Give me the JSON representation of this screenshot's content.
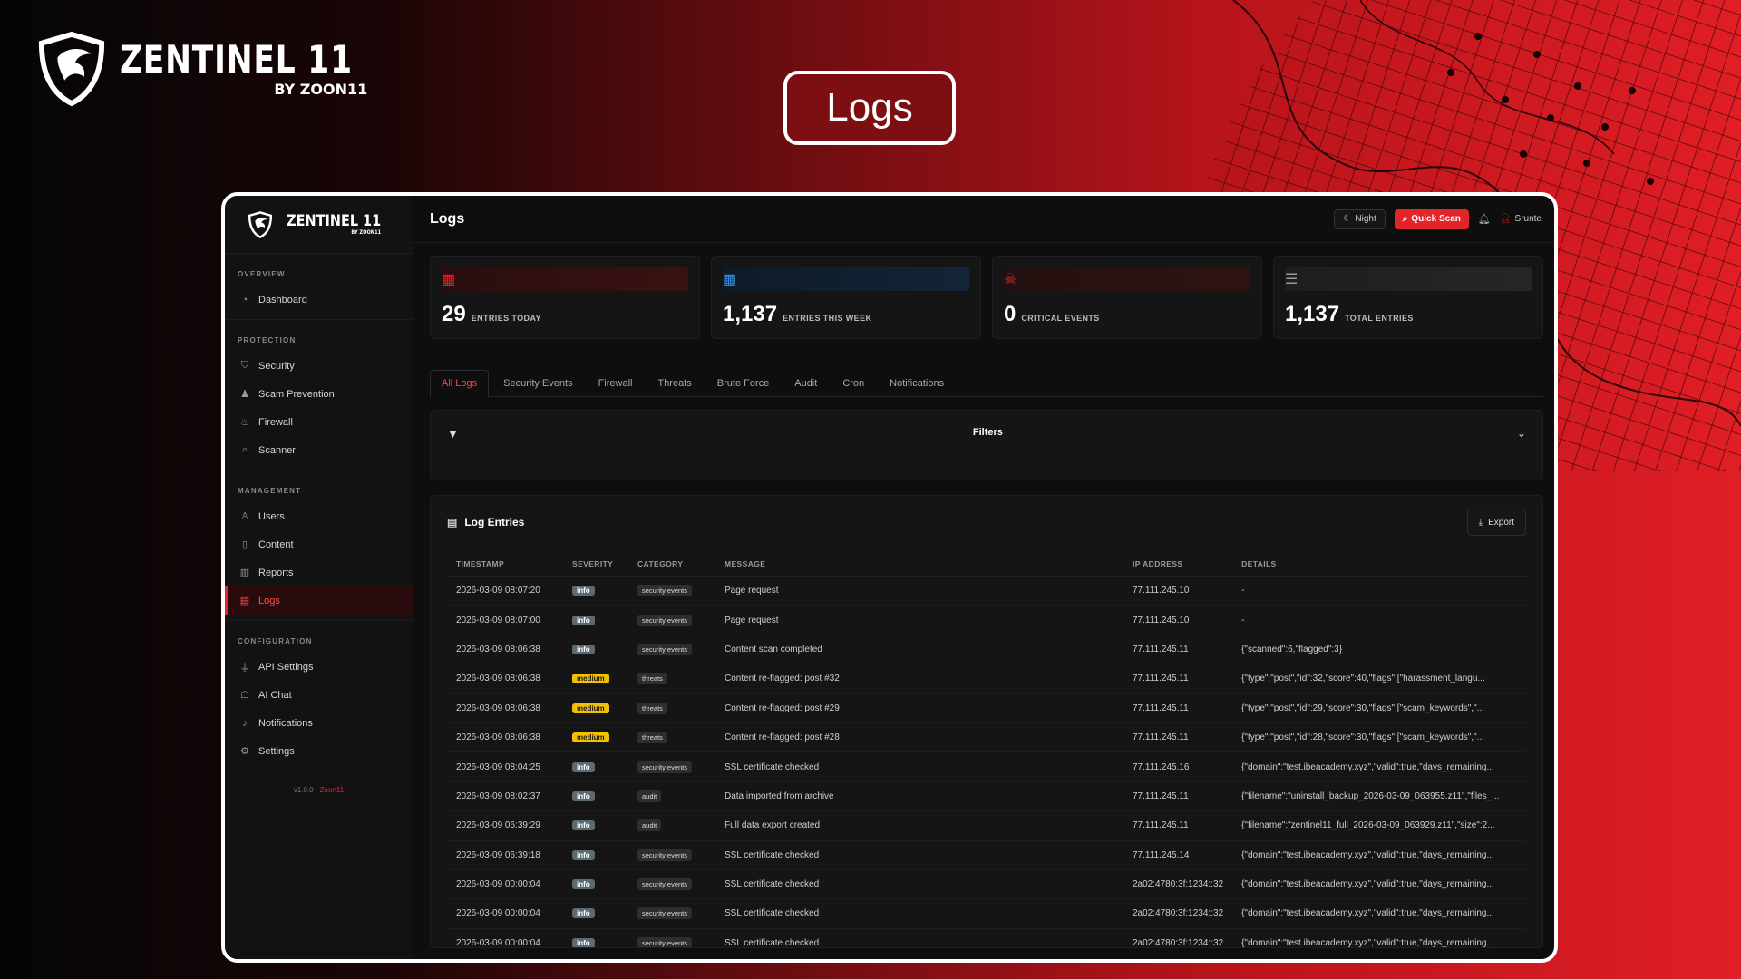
{
  "brand": {
    "name": "ZENTINEL 11",
    "by": "BY ZOON11"
  },
  "page_title": "Logs",
  "app": {
    "sidebar": {
      "logo": {
        "name": "ZENTINEL 11",
        "by": "BY ZOON11"
      },
      "sections": [
        {
          "heading": "OVERVIEW",
          "items": [
            {
              "label": "Dashboard",
              "icon": "gauge-icon"
            }
          ]
        },
        {
          "heading": "PROTECTION",
          "items": [
            {
              "label": "Security",
              "icon": "shield-icon"
            },
            {
              "label": "Scam Prevention",
              "icon": "user-secret-icon"
            },
            {
              "label": "Firewall",
              "icon": "fire-icon"
            },
            {
              "label": "Scanner",
              "icon": "search-icon"
            }
          ]
        },
        {
          "heading": "MANAGEMENT",
          "items": [
            {
              "label": "Users",
              "icon": "users-icon"
            },
            {
              "label": "Content",
              "icon": "file-icon"
            },
            {
              "label": "Reports",
              "icon": "chart-icon"
            },
            {
              "label": "Logs",
              "icon": "list-icon",
              "active": true
            }
          ]
        },
        {
          "heading": "CONFIGURATION",
          "items": [
            {
              "label": "API Settings",
              "icon": "plug-icon"
            },
            {
              "label": "AI Chat",
              "icon": "robot-icon"
            },
            {
              "label": "Notifications",
              "icon": "bell-icon"
            },
            {
              "label": "Settings",
              "icon": "gear-icon"
            }
          ]
        }
      ],
      "version": "v1.0.0 · ",
      "version_author": "Zoon11"
    },
    "topbar": {
      "title": "Logs",
      "night_label": "Night",
      "scan_label": "Quick Scan",
      "user_name": "Srunte"
    },
    "stats": [
      {
        "value": "29",
        "label": "ENTRIES TODAY",
        "icon": "calendar-icon",
        "color": "#e3242b"
      },
      {
        "value": "1,137",
        "label": "ENTRIES THIS WEEK",
        "icon": "calendar-week-icon",
        "color": "#3b8fe0"
      },
      {
        "value": "0",
        "label": "CRITICAL EVENTS",
        "icon": "skull-icon",
        "color": "#e3242b"
      },
      {
        "value": "1,137",
        "label": "TOTAL ENTRIES",
        "icon": "database-icon",
        "color": "#9a9a9a"
      }
    ],
    "tabs": [
      "All Logs",
      "Security Events",
      "Firewall",
      "Threats",
      "Brute Force",
      "Audit",
      "Cron",
      "Notifications"
    ],
    "filters": {
      "title": "Filters"
    },
    "log_entries": {
      "title": "Log Entries",
      "export_label": "Export",
      "columns": [
        "TIMESTAMP",
        "SEVERITY",
        "CATEGORY",
        "MESSAGE",
        "IP ADDRESS",
        "DETAILS"
      ],
      "rows": [
        {
          "ts": "2026-03-09 08:07:20",
          "sev": "info",
          "cat": "security events",
          "msg": "Page request",
          "ip": "77.111.245.10",
          "details": "-"
        },
        {
          "ts": "2026-03-09 08:07:00",
          "sev": "info",
          "cat": "security events",
          "msg": "Page request",
          "ip": "77.111.245.10",
          "details": "-"
        },
        {
          "ts": "2026-03-09 08:06:38",
          "sev": "info",
          "cat": "security events",
          "msg": "Content scan completed",
          "ip": "77.111.245.11",
          "details": "{\"scanned\":6,\"flagged\":3}"
        },
        {
          "ts": "2026-03-09 08:06:38",
          "sev": "medium",
          "cat": "threats",
          "msg": "Content re-flagged: post #32",
          "ip": "77.111.245.11",
          "details": "{\"type\":\"post\",\"id\":32,\"score\":40,\"flags\":[\"harassment_langu..."
        },
        {
          "ts": "2026-03-09 08:06:38",
          "sev": "medium",
          "cat": "threats",
          "msg": "Content re-flagged: post #29",
          "ip": "77.111.245.11",
          "details": "{\"type\":\"post\",\"id\":29,\"score\":30,\"flags\":[\"scam_keywords\",\"..."
        },
        {
          "ts": "2026-03-09 08:06:38",
          "sev": "medium",
          "cat": "threats",
          "msg": "Content re-flagged: post #28",
          "ip": "77.111.245.11",
          "details": "{\"type\":\"post\",\"id\":28,\"score\":30,\"flags\":[\"scam_keywords\",\"..."
        },
        {
          "ts": "2026-03-09 08:04:25",
          "sev": "info",
          "cat": "security events",
          "msg": "SSL certificate checked",
          "ip": "77.111.245.16",
          "details": "{\"domain\":\"test.ibeacademy.xyz\",\"valid\":true,\"days_remaining..."
        },
        {
          "ts": "2026-03-09 08:02:37",
          "sev": "info",
          "cat": "audit",
          "msg": "Data imported from archive",
          "ip": "77.111.245.11",
          "details": "{\"filename\":\"uninstall_backup_2026-03-09_063955.z11\",\"files_..."
        },
        {
          "ts": "2026-03-09 06:39:29",
          "sev": "info",
          "cat": "audit",
          "msg": "Full data export created",
          "ip": "77.111.245.11",
          "details": "{\"filename\":\"zentinel11_full_2026-03-09_063929.z11\",\"size\":2..."
        },
        {
          "ts": "2026-03-09 06:39:18",
          "sev": "info",
          "cat": "security events",
          "msg": "SSL certificate checked",
          "ip": "77.111.245.14",
          "details": "{\"domain\":\"test.ibeacademy.xyz\",\"valid\":true,\"days_remaining..."
        },
        {
          "ts": "2026-03-09 00:00:04",
          "sev": "info",
          "cat": "security events",
          "msg": "SSL certificate checked",
          "ip": "2a02:4780:3f:1234::32",
          "details": "{\"domain\":\"test.ibeacademy.xyz\",\"valid\":true,\"days_remaining..."
        },
        {
          "ts": "2026-03-09 00:00:04",
          "sev": "info",
          "cat": "security events",
          "msg": "SSL certificate checked",
          "ip": "2a02:4780:3f:1234::32",
          "details": "{\"domain\":\"test.ibeacademy.xyz\",\"valid\":true,\"days_remaining..."
        },
        {
          "ts": "2026-03-09 00:00:04",
          "sev": "info",
          "cat": "security events",
          "msg": "SSL certificate checked",
          "ip": "2a02:4780:3f:1234::32",
          "details": "{\"domain\":\"test.ibeacademy.xyz\",\"valid\":true,\"days_remaining..."
        }
      ]
    }
  }
}
